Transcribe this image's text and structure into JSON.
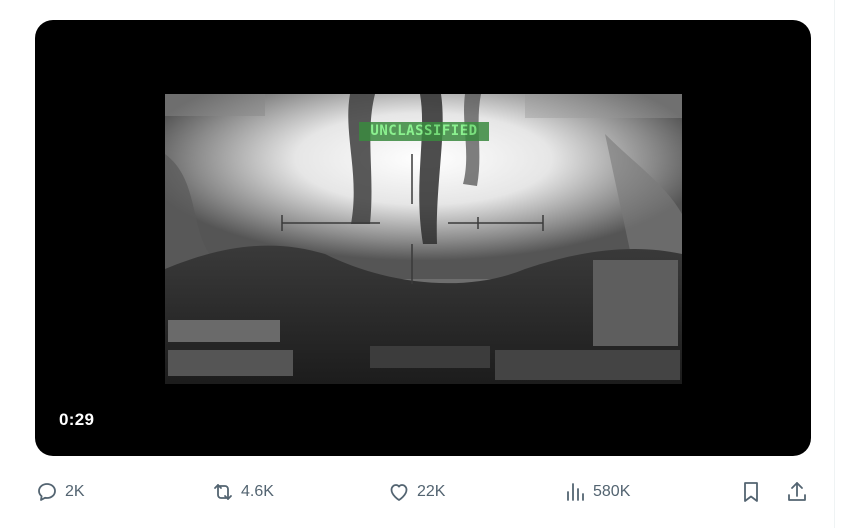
{
  "video": {
    "duration": "0:29",
    "overlay_text": "UNCLASSIFIED"
  },
  "actions": {
    "replies": "2K",
    "reposts": "4.6K",
    "likes": "22K",
    "views": "580K"
  },
  "icons": {
    "reply": "reply-icon",
    "repost": "repost-icon",
    "like": "heart-icon",
    "views": "views-chart-icon",
    "bookmark": "bookmark-icon",
    "share": "share-icon"
  },
  "colors": {
    "action_gray": "#536471",
    "video_bg": "#000000"
  }
}
